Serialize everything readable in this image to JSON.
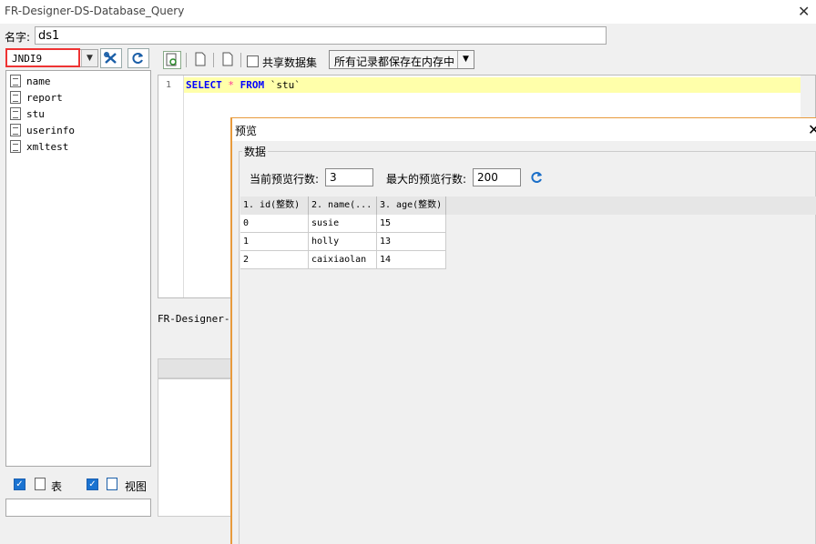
{
  "window": {
    "title": "FR-Designer-DS-Database_Query",
    "close": "✕"
  },
  "name_row": {
    "label": "名字:",
    "value": "ds1"
  },
  "left": {
    "connection": "JNDI9",
    "tables": [
      "name",
      "report",
      "stu",
      "userinfo",
      "xmltest"
    ],
    "table_check_label": "表",
    "view_check_label": "视图",
    "check_mark": "✓"
  },
  "editor": {
    "share_label": "共享数据集",
    "save_mode": "所有记录都保存在内存中",
    "line_number": "1",
    "sql": {
      "kw1": "SELECT",
      "star": "*",
      "kw2": "FROM",
      "rest": "`stu`"
    },
    "lower_label": "FR-Designer-Da"
  },
  "preview": {
    "title": "预览",
    "close": "✕",
    "group": "数据",
    "current_rows_label": "当前预览行数:",
    "current_rows": "3",
    "max_rows_label": "最大的预览行数:",
    "max_rows": "200",
    "columns": [
      "1. id(整数)",
      "2. name(...",
      "3. age(整数)"
    ],
    "rows": [
      [
        "0",
        "susie",
        "15"
      ],
      [
        "1",
        "holly",
        "13"
      ],
      [
        "2",
        "caixiaolan",
        "14"
      ]
    ]
  },
  "colors": {
    "accent": "#1a73d1",
    "highlight": "#ffffaa",
    "dialog_border": "#e89a3c",
    "red_box": "#ee3333"
  }
}
